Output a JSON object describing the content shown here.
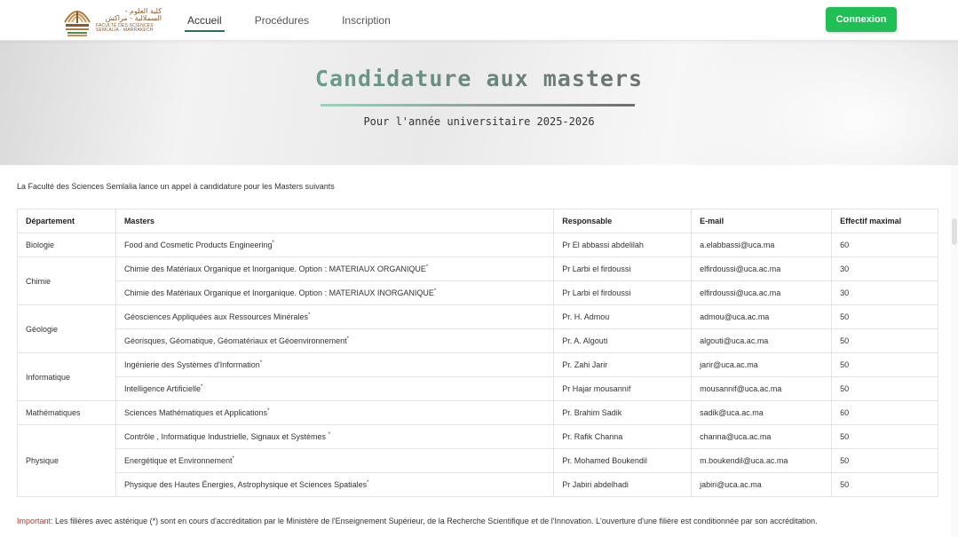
{
  "logo": {
    "arabic_text": "كلية العلوم - السملالية - مراكش",
    "french_text": "FACULTÉ DES SCIENCES SEMLALIA - MARRAKECH",
    "university_text": "MARRAKECH"
  },
  "nav": {
    "items": [
      {
        "label": "Accueil",
        "active": true
      },
      {
        "label": "Procédures",
        "active": false
      },
      {
        "label": "Inscription",
        "active": false
      }
    ],
    "login_label": "Connexion"
  },
  "hero": {
    "title": "Candidature aux masters",
    "subtitle": "Pour l'année universitaire 2025-2026"
  },
  "intro": "La Faculté des Sciences Semlalia lance un appel à candidature pour les Masters suivants",
  "table": {
    "headers": [
      "Département",
      "Masters",
      "Responsable",
      "E-mail",
      "Effectif maximal"
    ],
    "groups": [
      {
        "department": "Biologie",
        "rows": [
          {
            "master": "Food and Cosmetic Products Engineering",
            "star": "*",
            "responsable": "Pr El abbassi abdelilah",
            "email": "a.elabbassi@uca.ma",
            "effectif": "60"
          }
        ]
      },
      {
        "department": "Chimie",
        "rows": [
          {
            "master": "Chimie des Matériaux Organique et Inorganique. Option : MATERIAUX ORGANIQUE",
            "star": "*",
            "responsable": "Pr Larbi el firdoussi",
            "email": "elfirdoussi@uca.ac.ma",
            "effectif": "30"
          },
          {
            "master": "Chimie des Matériaux Organique et Inorganique. Option : MATERIAUX INORGANIQUE",
            "star": "*",
            "responsable": "Pr Larbi el firdoussi",
            "email": "elfirdoussi@uca.ac.ma",
            "effectif": "30"
          }
        ]
      },
      {
        "department": "Géologie",
        "rows": [
          {
            "master": "Géosciences Appliquées aux Ressources Minérales",
            "star": "*",
            "responsable": "Pr. H. Admou",
            "email": "admou@uca.ac.ma",
            "effectif": "50"
          },
          {
            "master": "Géorisques, Géomatique, Géomatériaux et Géoenvironnement",
            "star": "*",
            "responsable": "Pr. A. Algouti",
            "email": "algouti@uca.ac.ma",
            "effectif": "50"
          }
        ]
      },
      {
        "department": "Informatique",
        "rows": [
          {
            "master": "Ingénierie des Systèmes d'Information",
            "star": "*",
            "responsable": "Pr. Zahi Jarir",
            "email": "jarir@uca.ac.ma",
            "effectif": "50"
          },
          {
            "master": "Intelligence Artificielle",
            "star": "*",
            "responsable": "Pr Hajar mousannif",
            "email": "mousannif@uca.ac.ma",
            "effectif": "50"
          }
        ]
      },
      {
        "department": "Mathématiques",
        "rows": [
          {
            "master": "Sciences Mathématiques et Applications",
            "star": "*",
            "responsable": "Pr. Brahim Sadik",
            "email": "sadik@uca.ac.ma",
            "effectif": "60"
          }
        ]
      },
      {
        "department": "Physique",
        "rows": [
          {
            "master": "Contrôle , Informatique Industrielle, Signaux et Systèmes ",
            "star": "*",
            "responsable": "Pr. Rafik Channa",
            "email": "channa@uca.ac.ma",
            "effectif": "50"
          },
          {
            "master": "Energétique et Environnement",
            "star": "*",
            "responsable": "Pr. Mohamed Boukendil",
            "email": "m.boukendil@uca.ac.ma",
            "effectif": "50"
          },
          {
            "master": "Physique des Hautes Énergies, Astrophysique et Sciences Spatiales",
            "star": "*",
            "responsable": "Pr Jabiri abdelhadi",
            "email": "jabiri@uca.ac.ma",
            "effectif": "50"
          }
        ]
      }
    ]
  },
  "note": {
    "important_label": "Important:",
    "text": " Les filières avec astérique (*) sont en cours d'accréditation par le Ministère de l'Enseignement Supérieur, de la Recherche Scientifique et de l'Innovation. L'ouverture d'une filière est conditionnée par son accréditation."
  },
  "colors": {
    "login_button": "#20bf55",
    "active_tab_underline": "#2b6b62",
    "important": "#c0392b",
    "logo_brand": "#8a5a2b"
  }
}
